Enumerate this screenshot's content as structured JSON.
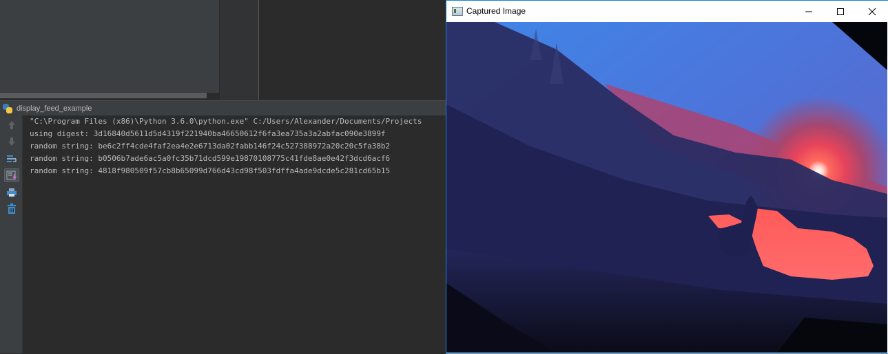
{
  "ide": {
    "run_tab_title": "display_feed_example",
    "toolbar": [
      {
        "name": "scroll-up-icon"
      },
      {
        "name": "scroll-down-icon"
      },
      {
        "name": "soft-wrap-icon"
      },
      {
        "name": "scroll-to-end-icon"
      },
      {
        "name": "print-icon"
      },
      {
        "name": "trash-icon"
      }
    ],
    "console_lines": [
      "\"C:\\Program Files (x86)\\Python 3.6.0\\python.exe\" C:/Users/Alexander/Documents/Projects",
      "using digest: 3d16840d5611d5d4319f221940ba46650612f6fa3ea735a3a2abfac090e3899f",
      "random string: be6c2ff4cde4faf2ea4e2e6713da02fabb146f24c527388972a20c20c5fa38b2",
      "random string: b0506b7ade6ac5a0fc35b71dcd599e19870108775c41fde8ae0e42f3dcd6acf6",
      "random string: 4818f980509f57cb8b65099d766d43cd98f503fdffa4ade9dcde5c281cd65b15"
    ]
  },
  "window": {
    "title": "Captured Image",
    "minimize_icon": "minimize-icon",
    "maximize_icon": "maximize-icon",
    "close_icon": "close-icon",
    "accent_color": "#1883d7"
  },
  "colors": {
    "console_text": "#bbbbbb",
    "console_bg": "#2b2b2b",
    "panel_bg": "#3c3f41"
  }
}
